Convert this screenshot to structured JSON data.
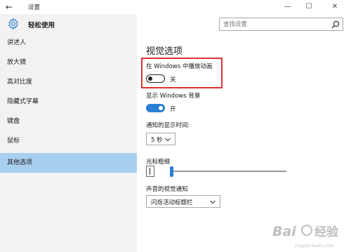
{
  "titlebar": {
    "back_glyph": "←",
    "title": "设置",
    "minimize_glyph": "—",
    "maximize_glyph": "☐",
    "close_glyph": "✕"
  },
  "sidebar": {
    "title": "轻松使用",
    "items": [
      {
        "label": "讲述人"
      },
      {
        "label": "放大镜"
      },
      {
        "label": "高对比度"
      },
      {
        "label": "隐藏式字幕"
      },
      {
        "label": "键盘"
      },
      {
        "label": "鼠标"
      },
      {
        "label": "其他选项"
      }
    ],
    "active_index": 6
  },
  "search": {
    "placeholder": "查找设置"
  },
  "main": {
    "section_title": "视觉选项",
    "animations": {
      "label": "在 Windows 中播放动画",
      "state_text": "关",
      "on": false
    },
    "background": {
      "label": "显示 Windows 背景",
      "state_text": "开",
      "on": true
    },
    "notification_time": {
      "label": "通知的显示时间:",
      "value": "5 秒"
    },
    "cursor_thickness": {
      "label": "光标粗细",
      "level": 1
    },
    "visual_notification": {
      "label": "声音的视觉通知",
      "value": "闪烁活动标题栏"
    }
  },
  "colors": {
    "accent": "#2a7ed3",
    "sidebar_bg": "#f2f2f2",
    "active_item_bg": "#a9cfee",
    "highlight_border": "#e03131"
  },
  "watermark": {
    "text": "Baidu 经验"
  }
}
